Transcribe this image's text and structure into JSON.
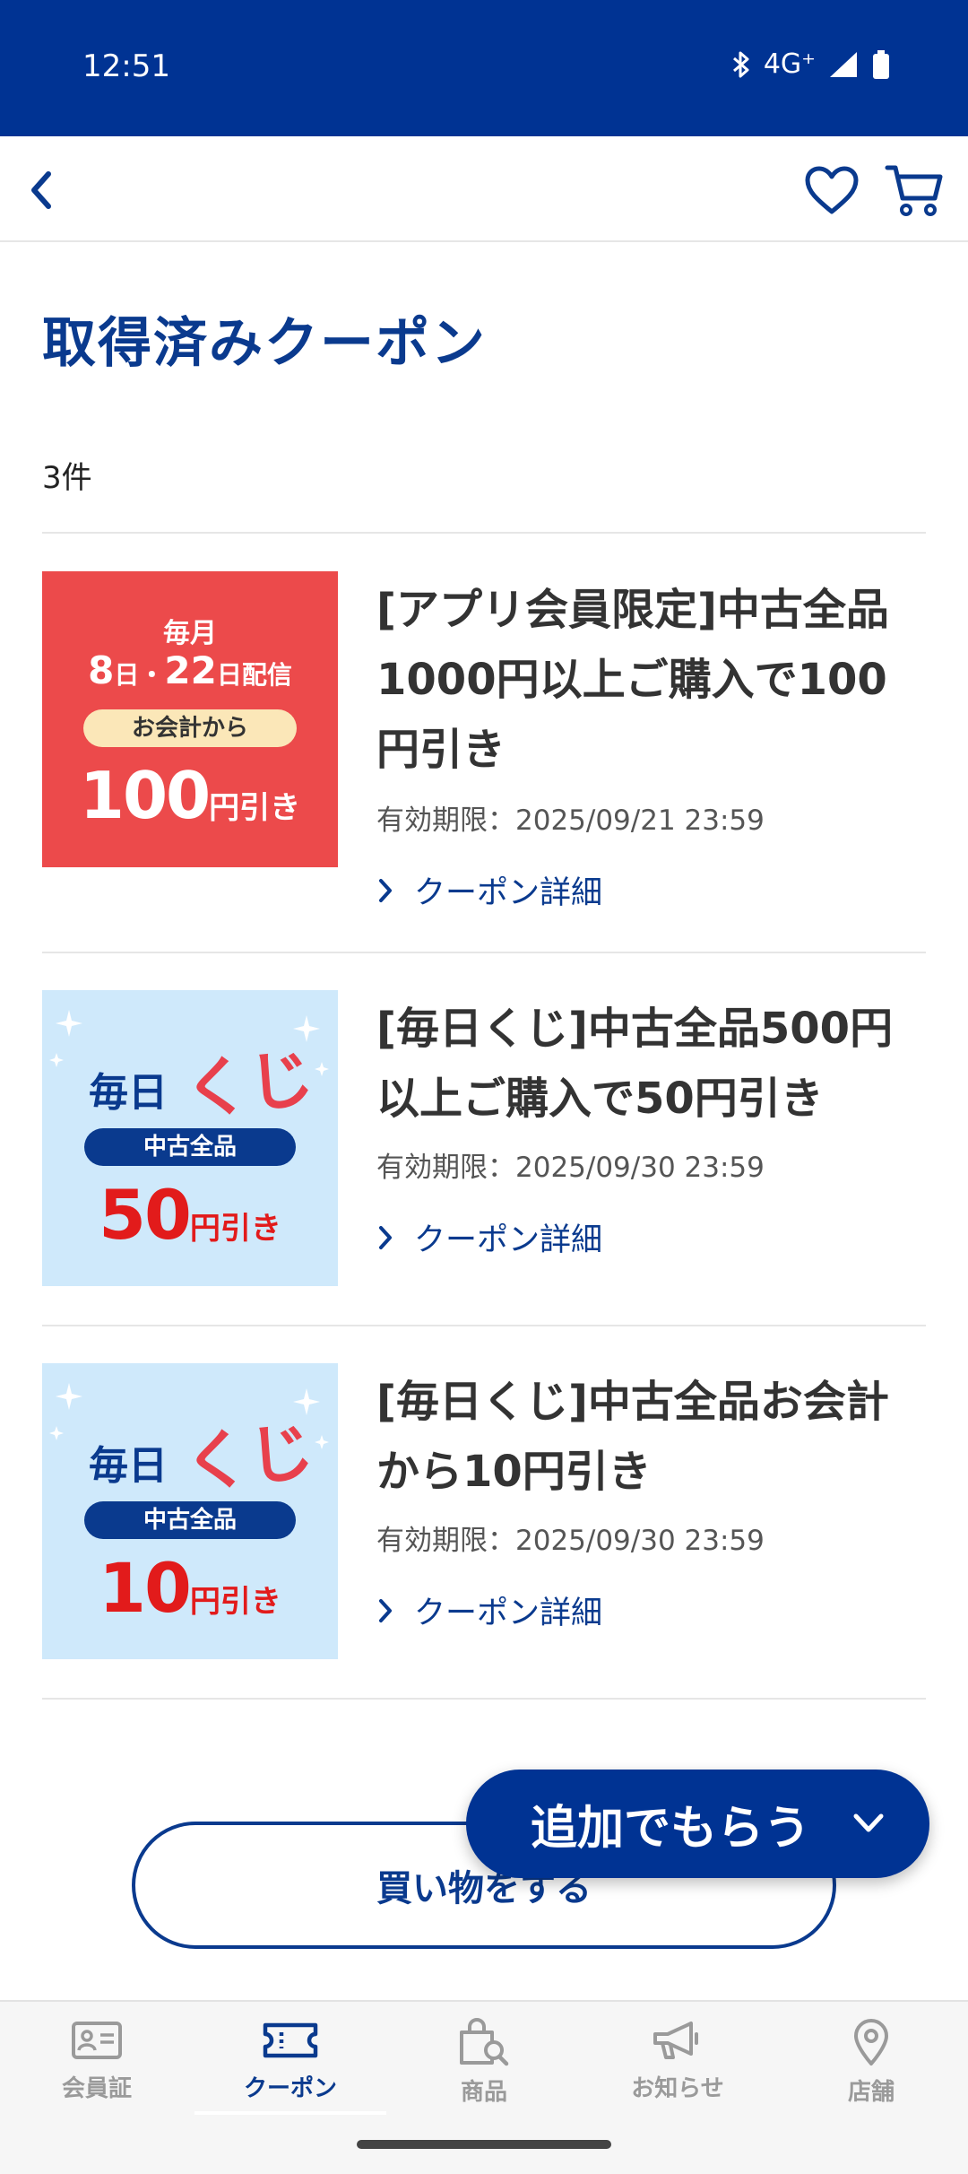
{
  "status_bar": {
    "time": "12:51",
    "network": "4G⁺"
  },
  "page": {
    "title": "取得済みクーポン",
    "count": "3件"
  },
  "coupons": [
    {
      "title": "[アプリ会員限定]中古全品1000円以上ご購入で100円引き",
      "expiry": "有効期限：2025/09/21 23:59",
      "link": "クーポン詳細",
      "thumb": {
        "l1": "毎月",
        "l2a": "8",
        "l2b": "日・",
        "l2c": "22",
        "l2d": "日配信",
        "pill": "お会計から",
        "num": "100",
        "unit": "円引き"
      }
    },
    {
      "title": "[毎日くじ]中古全品500円以上ご購入で50円引き",
      "expiry": "有効期限：2025/09/30 23:59",
      "link": "クーポン詳細",
      "thumb": {
        "l1a": "毎日",
        "l1b": "くじ",
        "pill": "中古全品",
        "num": "50",
        "unit": "円引き"
      }
    },
    {
      "title": "[毎日くじ]中古全品お会計から10円引き",
      "expiry": "有効期限：2025/09/30 23:59",
      "link": "クーポン詳細",
      "thumb": {
        "l1a": "毎日",
        "l1b": "くじ",
        "pill": "中古全品",
        "num": "10",
        "unit": "円引き"
      }
    }
  ],
  "buttons": {
    "shop": "買い物をする",
    "extra": "追加でもらう"
  },
  "nav": [
    {
      "label": "会員証"
    },
    {
      "label": "クーポン"
    },
    {
      "label": "商品"
    },
    {
      "label": "お知らせ"
    },
    {
      "label": "店舗"
    }
  ],
  "colors": {
    "primary": "#003393",
    "accent_red": "#ec4a4b",
    "light_blue": "#cfe9fb"
  }
}
